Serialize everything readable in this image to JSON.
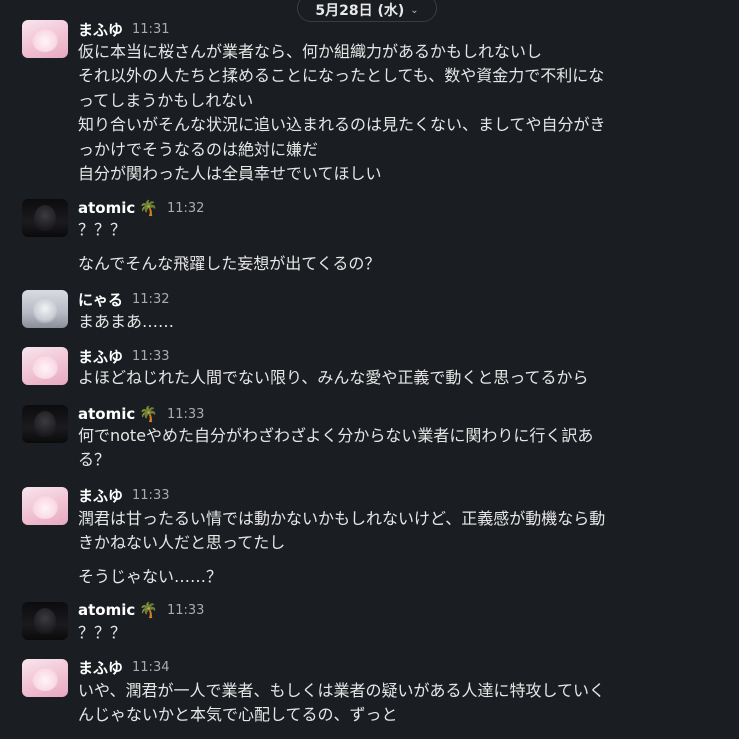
{
  "date_divider": {
    "label": "5月28日 (水)",
    "chevron_icon": "chevron-down-icon"
  },
  "messages": [
    {
      "name": "まふゆ",
      "emoji": "",
      "time": "11:31",
      "avatar": "pink-hair-avatar",
      "lines": [
        "仮に本当に桜さんが業者なら、何か組織力があるかもしれないし",
        "それ以外の人たちと揉めることになったとしても、数や資金力で不利にな",
        "ってしまうかもしれない",
        "知り合いがそんな状況に追い込まれるのは見たくない、ましてや自分がき",
        "っかけでそうなるのは絶対に嫌だ",
        "自分が関わった人は全員幸せでいてほしい"
      ]
    },
    {
      "name": "atomic",
      "emoji": "🌴",
      "time": "11:32",
      "avatar": "dark-avatar",
      "lines": [
        "？？？"
      ],
      "followup": [
        "なんでそんな飛躍した妄想が出てくるの？"
      ]
    },
    {
      "name": "にゃる",
      "emoji": "",
      "time": "11:32",
      "avatar": "silver-hair-avatar",
      "lines": [
        "まあまあ……"
      ]
    },
    {
      "name": "まふゆ",
      "emoji": "",
      "time": "11:33",
      "avatar": "pink-hair-avatar",
      "lines": [
        "よほどねじれた人間でない限り、みんな愛や正義で動くと思ってるから"
      ]
    },
    {
      "name": "atomic",
      "emoji": "🌴",
      "time": "11:33",
      "avatar": "dark-avatar",
      "lines": [
        "何でnoteやめた自分がわざわざよく分からない業者に関わりに行く訳あ",
        "る？"
      ]
    },
    {
      "name": "まふゆ",
      "emoji": "",
      "time": "11:33",
      "avatar": "pink-hair-avatar",
      "lines": [
        "潤君は甘ったるい情では動かないかもしれないけど、正義感が動機なら動",
        "きかねない人だと思ってたし"
      ],
      "followup": [
        "そうじゃない……？"
      ]
    },
    {
      "name": "atomic",
      "emoji": "🌴",
      "time": "11:33",
      "avatar": "dark-avatar",
      "lines": [
        "？？？"
      ]
    },
    {
      "name": "まふゆ",
      "emoji": "",
      "time": "11:34",
      "avatar": "pink-hair-avatar",
      "lines": [
        "いや、潤君が一人で業者、もしくは業者の疑いがある人達に特攻していく",
        "んじゃないかと本気で心配してるの、ずっと"
      ]
    }
  ]
}
